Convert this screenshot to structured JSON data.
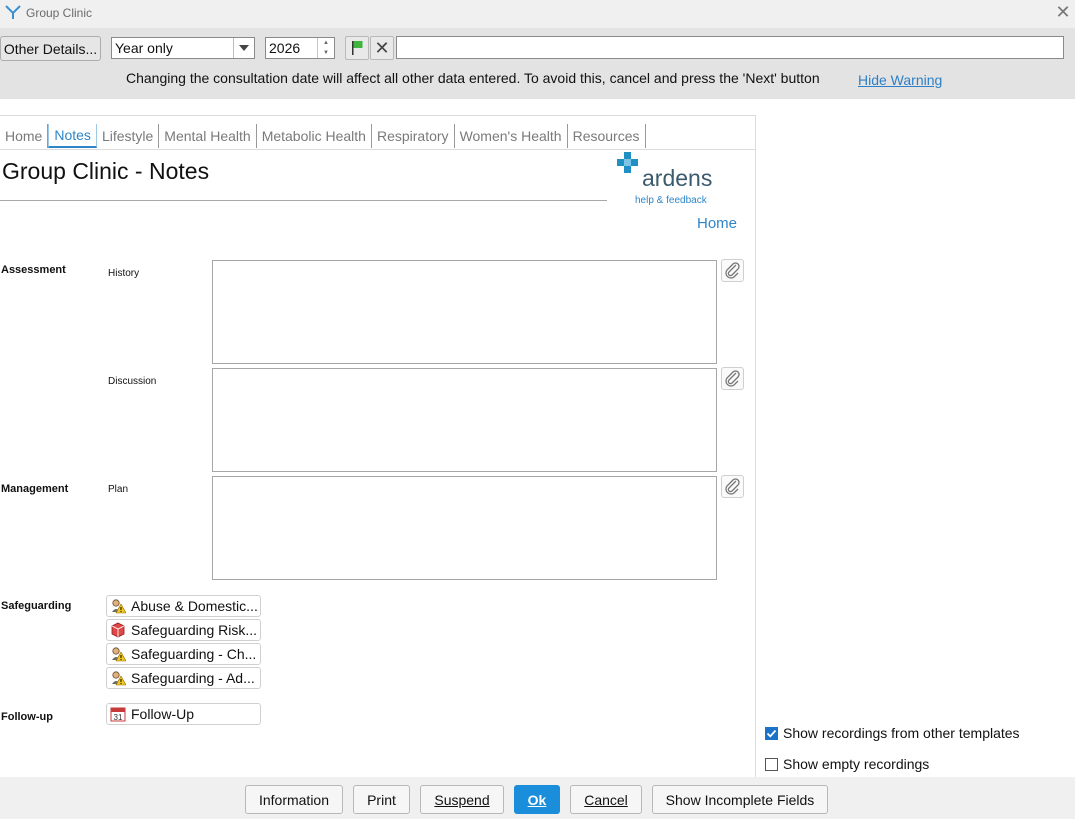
{
  "window": {
    "title": "Group Clinic",
    "close_glyph": "✕"
  },
  "toolbar": {
    "other_details_label": "Other Details...",
    "period_select_value": "Year only",
    "year_value": "2026",
    "clear_glyph": "✕",
    "warning_text": "Changing the consultation date will affect all other data entered. To avoid this, cancel and press the 'Next' button",
    "hide_warning_label": "Hide Warning"
  },
  "tabs": [
    "Home",
    "Notes",
    "Lifestyle",
    "Mental Health",
    "Metabolic Health",
    "Respiratory",
    "Women's Health",
    "Resources"
  ],
  "active_tab": "Notes",
  "page": {
    "title": "Group Clinic - Notes",
    "brand_name": "ardens",
    "help_feedback": "help & feedback",
    "home_link": "Home"
  },
  "sections": {
    "assessment": "Assessment",
    "management": "Management",
    "safeguarding": "Safeguarding",
    "follow_up": "Follow-up"
  },
  "fields": {
    "history": "History",
    "discussion": "Discussion",
    "plan": "Plan"
  },
  "safeguarding_items": [
    {
      "label": "Abuse & Domestic...",
      "icon": "warning-person-icon"
    },
    {
      "label": "Safeguarding Risk...",
      "icon": "cube-icon"
    },
    {
      "label": "Safeguarding - Ch...",
      "icon": "warning-person-icon"
    },
    {
      "label": "Safeguarding - Ad...",
      "icon": "warning-person-icon"
    }
  ],
  "follow_up_item": {
    "label": "Follow-Up",
    "icon": "calendar-icon",
    "calendar_day": "31"
  },
  "options": {
    "show_other_templates": "Show recordings from other templates",
    "show_other_templates_checked": true,
    "show_empty": "Show empty recordings",
    "show_empty_checked": false
  },
  "buttons": {
    "information": "Information",
    "print": "Print",
    "suspend": "Suspend",
    "ok": "Ok",
    "cancel": "Cancel",
    "show_incomplete": "Show Incomplete Fields"
  },
  "colors": {
    "accent": "#2e86c9",
    "ok_button": "#1a8ddb",
    "brand_teal": "#1f8fc4",
    "brand_text": "#3c5a6d"
  }
}
